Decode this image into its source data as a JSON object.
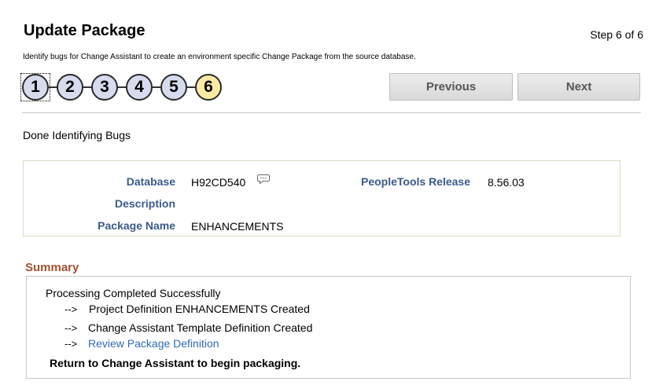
{
  "header": {
    "title": "Update Package",
    "step_of": "Step 6 of 6",
    "instructions": "Identify bugs for Change Assistant to create an environment specific Change Package from the source database."
  },
  "train": {
    "steps": [
      "1",
      "2",
      "3",
      "4",
      "5",
      "6"
    ],
    "current_step": "6"
  },
  "buttons": {
    "previous": "Previous",
    "next": "Next"
  },
  "status": "Done Identifying Bugs",
  "info": {
    "database_label": "Database",
    "database_value": "H92CD540",
    "description_label": "Description",
    "description_value": "",
    "package_name_label": "Package Name",
    "package_name_value": "ENHANCEMENTS",
    "peopletools_label": "PeopleTools Release",
    "peopletools_value": "8.56.03"
  },
  "summary": {
    "heading": "Summary",
    "processing": "Processing Completed Successfully",
    "arrow": "-->",
    "line1": "Project Definition ENHANCEMENTS Created",
    "line2": "Change Assistant Template Definition Created",
    "line3_link": "Review Package Definition",
    "return_msg": "Return to Change Assistant to begin packaging."
  },
  "colors": {
    "label_blue": "#3b5a8c",
    "summary_heading": "#a0522d",
    "link": "#2f6bb3",
    "step_bg": "#d6dcee",
    "current_step_bg": "#fce9a3"
  }
}
